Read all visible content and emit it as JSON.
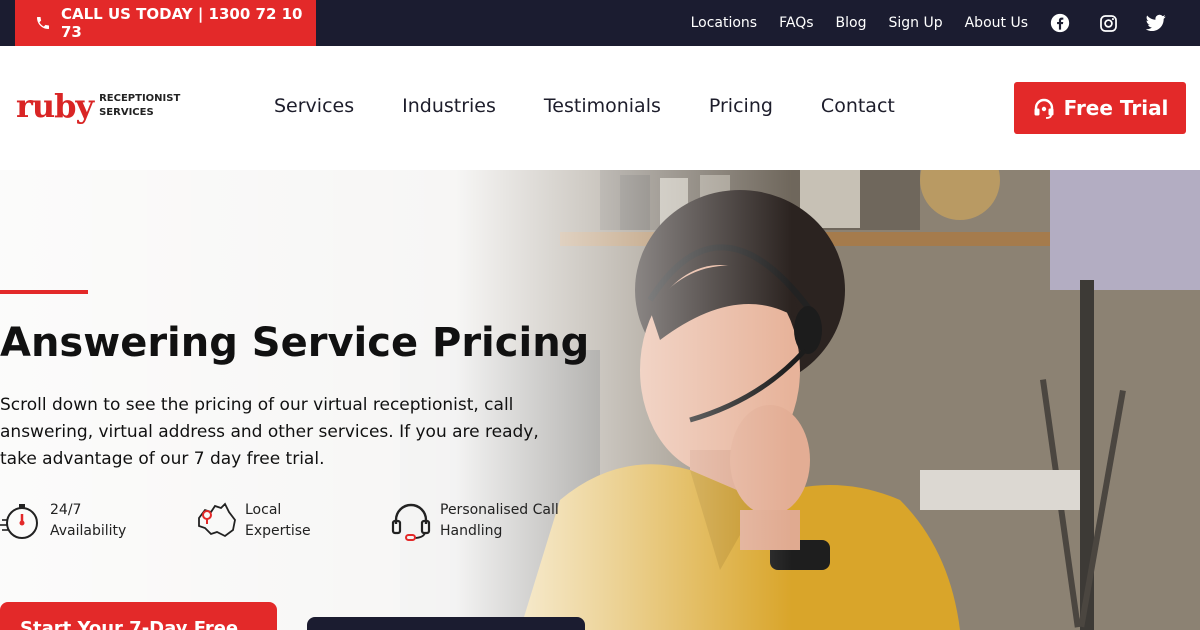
{
  "topbar": {
    "call_label": "CALL US TODAY | 1300 72 10 73",
    "links": [
      "Locations",
      "FAQs",
      "Blog",
      "Sign Up",
      "About Us"
    ],
    "social_icons": [
      "facebook-icon",
      "instagram-icon",
      "twitter-icon"
    ]
  },
  "header": {
    "logo_word": "ruby",
    "logo_sub_line1": "RECEPTIONIST",
    "logo_sub_line2": "SERVICES",
    "nav": [
      "Services",
      "Industries",
      "Testimonials",
      "Pricing",
      "Contact"
    ],
    "cta_label": "Free Trial"
  },
  "hero": {
    "title": "Answering Service Pricing",
    "text": "Scroll down to see the pricing of our virtual receptionist, call answering, virtual address and other services. If you are ready, take advantage of our 7 day free trial.",
    "features": [
      {
        "icon": "stopwatch-icon",
        "label": "24/7\nAvailability"
      },
      {
        "icon": "australia-map-icon",
        "label": "Local\nExpertise"
      },
      {
        "icon": "headset-icon",
        "label": "Personalised Call\nHandling"
      }
    ],
    "start_button_label": "Start Your 7-Day Free"
  },
  "colors": {
    "accent": "#e32929",
    "dark": "#1b1c30"
  }
}
